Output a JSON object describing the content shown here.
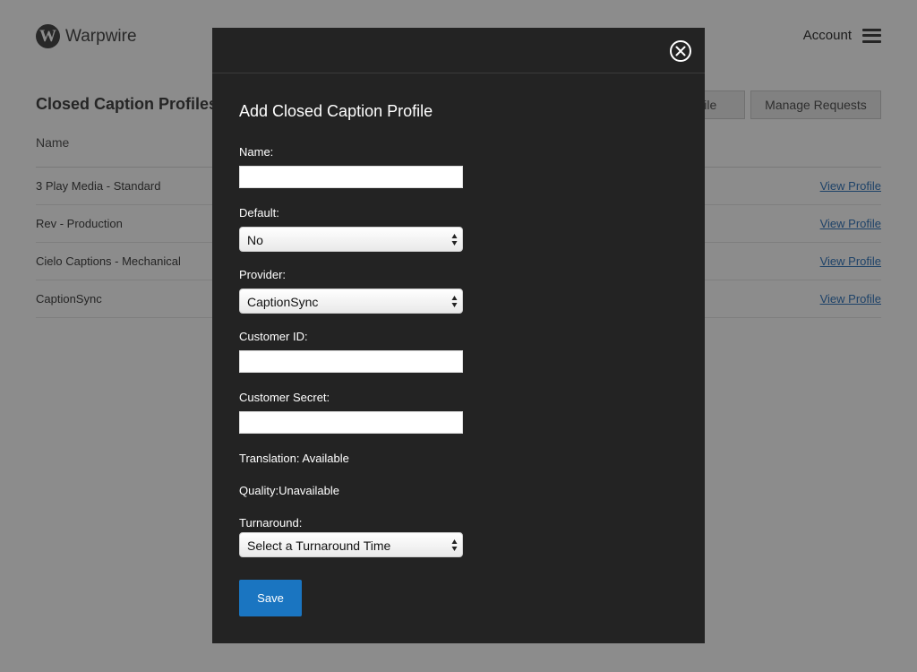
{
  "brand": {
    "name": "Warpwire",
    "logo_letter": "W"
  },
  "header": {
    "account_label": "Account",
    "menu_icon": "hamburger-icon"
  },
  "page": {
    "title": "Closed Caption Profiles",
    "add_profile_button": "Add Profile",
    "manage_requests_button": "Manage Requests",
    "column_name": "Name",
    "rows": [
      {
        "name": "3 Play Media - Standard",
        "link": "View Profile"
      },
      {
        "name": "Rev - Production",
        "link": "View Profile"
      },
      {
        "name": "Cielo Captions - Mechanical",
        "link": "View Profile"
      },
      {
        "name": "CaptionSync",
        "link": "View Profile"
      }
    ]
  },
  "modal": {
    "title": "Add Closed Caption Profile",
    "close_icon": "close-circle-icon",
    "name_label": "Name:",
    "name_value": "",
    "default_label": "Default:",
    "default_value": "No",
    "provider_label": "Provider:",
    "provider_value": "CaptionSync",
    "customer_id_label": "Customer ID:",
    "customer_id_value": "",
    "customer_secret_label": "Customer Secret:",
    "customer_secret_value": "",
    "translation_text": "Translation: Available",
    "quality_text": "Quality:Unavailable",
    "turnaround_label": "Turnaround:",
    "turnaround_value": "Select a Turnaround Time",
    "save_label": "Save"
  },
  "colors": {
    "modal_bg": "#232323",
    "save_button": "#1a75c1",
    "link": "#3a7bbf"
  }
}
